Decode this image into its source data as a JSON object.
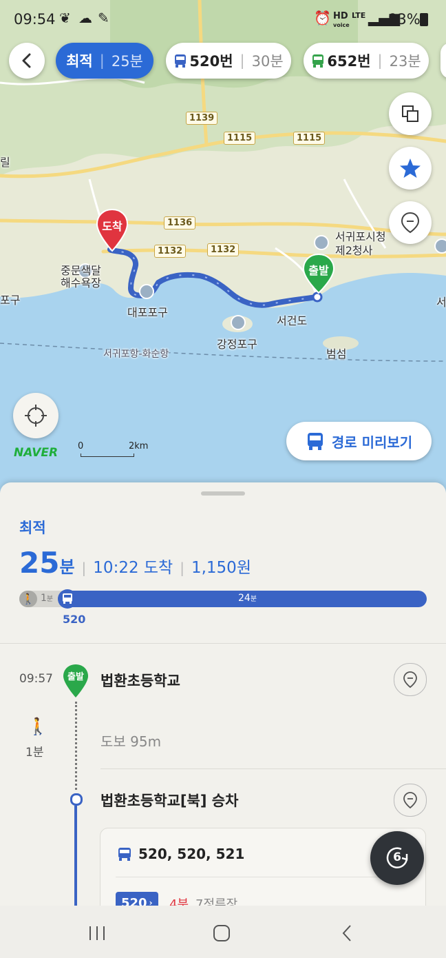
{
  "status_bar": {
    "time": "09:54",
    "battery": "93%",
    "hd_label": "HD",
    "hd_sub": "voice",
    "lte_label": "LTE"
  },
  "route_options": [
    {
      "label": "최적",
      "duration": "25분",
      "selected": true
    },
    {
      "label": "520번",
      "duration": "30분",
      "icon": "bus-icon",
      "color": "#3a63c4"
    },
    {
      "label": "652번",
      "duration": "23분",
      "icon": "bus-icon",
      "color": "#34a34b"
    }
  ],
  "map": {
    "markers": {
      "arrival": "도착",
      "departure": "출발"
    },
    "place_labels": {
      "jungmun": "중문색달\n해수욕장",
      "daepo": "대포포구",
      "gangjeong": "강정포구",
      "seogeondo": "서건도",
      "city_hall": "서귀포시청\n제2청사",
      "beomseom": "범섬",
      "harbor_route": "서귀포항-화순항",
      "left_edge": "포구",
      "left_edge2": "릴",
      "right_edge": "서"
    },
    "road_numbers": [
      "1139",
      "1115",
      "1115",
      "1136",
      "1132",
      "1132"
    ],
    "brand": "NAVER",
    "scale": {
      "zero": "0",
      "distance": "2km"
    },
    "preview_button": "경로 미리보기",
    "colors": {
      "route": "#3a63c4",
      "arrival": "#e0343f",
      "departure": "#2aa84a",
      "sea": "#a9d3ee"
    }
  },
  "summary": {
    "label": "최적",
    "minutes": "25",
    "minutes_unit": "분",
    "arrival": "10:22 도착",
    "fare": "1,150원",
    "walk_minutes": "1",
    "walk_unit": "분",
    "bus_minutes": "24",
    "bus_unit": "분",
    "bus_number": "520"
  },
  "steps": {
    "start_time": "09:57",
    "start_badge": "출발",
    "start_name": "법환초등학교",
    "walk_duration": "1분",
    "walk_text": "도보 95m",
    "board_stop": "법환초등학교[북] 승차",
    "bus_list": "520, 520, 521",
    "bus_chip": "520",
    "bus_arrival": "4분",
    "bus_stops_away": "7정류장"
  },
  "floating_badge": "6"
}
